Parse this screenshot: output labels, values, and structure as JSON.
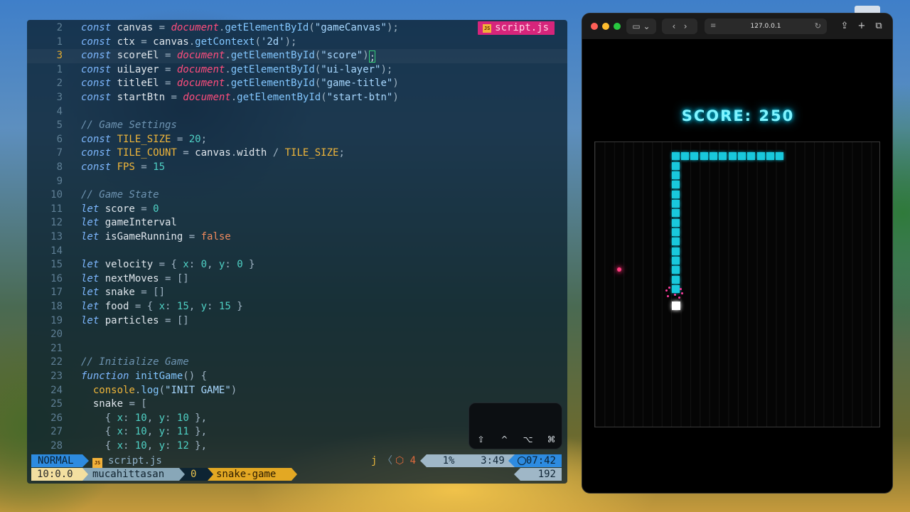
{
  "editor": {
    "file_tab": "script.js",
    "file_badge": "JS",
    "lines": [
      {
        "n": "2",
        "parts": [
          [
            "kw",
            "const "
          ],
          [
            "var",
            "canvas "
          ],
          [
            "punct",
            "= "
          ],
          [
            "glob",
            "document"
          ],
          [
            "punct",
            "."
          ],
          [
            "fn",
            "getElementById"
          ],
          [
            "punct",
            "("
          ],
          [
            "str",
            "\"gameCanvas\""
          ],
          [
            "punct",
            ");"
          ]
        ]
      },
      {
        "n": "1",
        "parts": [
          [
            "kw",
            "const "
          ],
          [
            "var",
            "ctx "
          ],
          [
            "punct",
            "= "
          ],
          [
            "var",
            "canvas"
          ],
          [
            "punct",
            "."
          ],
          [
            "fn",
            "getContext"
          ],
          [
            "punct",
            "("
          ],
          [
            "str",
            "'2d'"
          ],
          [
            "punct",
            ");"
          ]
        ]
      },
      {
        "n": "3",
        "cur": true,
        "parts": [
          [
            "kw",
            "const "
          ],
          [
            "var",
            "scoreEl "
          ],
          [
            "punct",
            "= "
          ],
          [
            "glob",
            "document"
          ],
          [
            "punct",
            "."
          ],
          [
            "fn",
            "getElementById"
          ],
          [
            "punct",
            "("
          ],
          [
            "str",
            "\"score\""
          ],
          [
            "punct",
            ")"
          ],
          [
            "caret",
            ";"
          ]
        ]
      },
      {
        "n": "1",
        "parts": [
          [
            "kw",
            "const "
          ],
          [
            "var",
            "uiLayer "
          ],
          [
            "punct",
            "= "
          ],
          [
            "glob",
            "document"
          ],
          [
            "punct",
            "."
          ],
          [
            "fn",
            "getElementById"
          ],
          [
            "punct",
            "("
          ],
          [
            "str",
            "\"ui-layer\""
          ],
          [
            "punct",
            ");"
          ]
        ]
      },
      {
        "n": "2",
        "parts": [
          [
            "kw",
            "const "
          ],
          [
            "var",
            "titleEl "
          ],
          [
            "punct",
            "= "
          ],
          [
            "glob",
            "document"
          ],
          [
            "punct",
            "."
          ],
          [
            "fn",
            "getElementById"
          ],
          [
            "punct",
            "("
          ],
          [
            "str",
            "\"game-title\""
          ],
          [
            "punct",
            ")"
          ]
        ]
      },
      {
        "n": "3",
        "parts": [
          [
            "kw",
            "const "
          ],
          [
            "var",
            "startBtn "
          ],
          [
            "punct",
            "= "
          ],
          [
            "glob",
            "document"
          ],
          [
            "punct",
            "."
          ],
          [
            "fn",
            "getElementById"
          ],
          [
            "punct",
            "("
          ],
          [
            "str",
            "\"start-btn\""
          ],
          [
            "punct",
            ")"
          ]
        ]
      },
      {
        "n": "4",
        "parts": []
      },
      {
        "n": "5",
        "parts": [
          [
            "cmt",
            "// Game Settings"
          ]
        ]
      },
      {
        "n": "6",
        "parts": [
          [
            "kw",
            "const "
          ],
          [
            "const",
            "TILE_SIZE "
          ],
          [
            "punct",
            "= "
          ],
          [
            "num",
            "20"
          ],
          [
            "punct",
            ";"
          ]
        ]
      },
      {
        "n": "7",
        "parts": [
          [
            "kw",
            "const "
          ],
          [
            "const",
            "TILE_COUNT "
          ],
          [
            "punct",
            "= "
          ],
          [
            "var",
            "canvas"
          ],
          [
            "punct",
            "."
          ],
          [
            "var",
            "width "
          ],
          [
            "punct",
            "/ "
          ],
          [
            "const",
            "TILE_SIZE"
          ],
          [
            "punct",
            ";"
          ]
        ]
      },
      {
        "n": "8",
        "parts": [
          [
            "kw",
            "const "
          ],
          [
            "const",
            "FPS "
          ],
          [
            "punct",
            "= "
          ],
          [
            "num",
            "15"
          ]
        ]
      },
      {
        "n": "9",
        "parts": []
      },
      {
        "n": "10",
        "parts": [
          [
            "cmt",
            "// Game State"
          ]
        ]
      },
      {
        "n": "11",
        "parts": [
          [
            "kw",
            "let "
          ],
          [
            "var",
            "score "
          ],
          [
            "punct",
            "= "
          ],
          [
            "num",
            "0"
          ]
        ]
      },
      {
        "n": "12",
        "parts": [
          [
            "kw",
            "let "
          ],
          [
            "var",
            "gameInterval"
          ]
        ]
      },
      {
        "n": "13",
        "parts": [
          [
            "kw",
            "let "
          ],
          [
            "var",
            "isGameRunning "
          ],
          [
            "punct",
            "= "
          ],
          [
            "bool",
            "false"
          ]
        ]
      },
      {
        "n": "14",
        "parts": []
      },
      {
        "n": "15",
        "parts": [
          [
            "kw",
            "let "
          ],
          [
            "var",
            "velocity "
          ],
          [
            "punct",
            "= { "
          ],
          [
            "num",
            "x"
          ],
          [
            "punct",
            ": "
          ],
          [
            "num",
            "0"
          ],
          [
            "punct",
            ", "
          ],
          [
            "num",
            "y"
          ],
          [
            "punct",
            ": "
          ],
          [
            "num",
            "0"
          ],
          [
            "punct",
            " }"
          ]
        ]
      },
      {
        "n": "16",
        "parts": [
          [
            "kw",
            "let "
          ],
          [
            "var",
            "nextMoves "
          ],
          [
            "punct",
            "= []"
          ]
        ]
      },
      {
        "n": "17",
        "parts": [
          [
            "kw",
            "let "
          ],
          [
            "var",
            "snake "
          ],
          [
            "punct",
            "= []"
          ]
        ]
      },
      {
        "n": "18",
        "parts": [
          [
            "kw",
            "let "
          ],
          [
            "var",
            "food "
          ],
          [
            "punct",
            "= { "
          ],
          [
            "num",
            "x"
          ],
          [
            "punct",
            ": "
          ],
          [
            "num",
            "15"
          ],
          [
            "punct",
            ", "
          ],
          [
            "num",
            "y"
          ],
          [
            "punct",
            ": "
          ],
          [
            "num",
            "15"
          ],
          [
            "punct",
            " }"
          ]
        ]
      },
      {
        "n": "19",
        "parts": [
          [
            "kw",
            "let "
          ],
          [
            "var",
            "particles "
          ],
          [
            "punct",
            "= []"
          ]
        ]
      },
      {
        "n": "20",
        "parts": []
      },
      {
        "n": "21",
        "parts": []
      },
      {
        "n": "22",
        "parts": [
          [
            "cmt",
            "// Initialize Game"
          ]
        ]
      },
      {
        "n": "23",
        "parts": [
          [
            "kw",
            "function "
          ],
          [
            "fn",
            "initGame"
          ],
          [
            "punct",
            "() {"
          ]
        ]
      },
      {
        "n": "24",
        "parts": [
          [
            "punct",
            "  "
          ],
          [
            "const",
            "console"
          ],
          [
            "punct",
            "."
          ],
          [
            "fn",
            "log"
          ],
          [
            "punct",
            "("
          ],
          [
            "str",
            "\"INIT GAME\""
          ],
          [
            "punct",
            ")"
          ]
        ]
      },
      {
        "n": "25",
        "parts": [
          [
            "punct",
            "  "
          ],
          [
            "var",
            "snake "
          ],
          [
            "punct",
            "= ["
          ]
        ]
      },
      {
        "n": "26",
        "parts": [
          [
            "punct",
            "    { "
          ],
          [
            "num",
            "x"
          ],
          [
            "punct",
            ": "
          ],
          [
            "num",
            "10"
          ],
          [
            "punct",
            ", "
          ],
          [
            "num",
            "y"
          ],
          [
            "punct",
            ": "
          ],
          [
            "num",
            "10"
          ],
          [
            "punct",
            " },"
          ]
        ]
      },
      {
        "n": "27",
        "parts": [
          [
            "punct",
            "    { "
          ],
          [
            "num",
            "x"
          ],
          [
            "punct",
            ": "
          ],
          [
            "num",
            "10"
          ],
          [
            "punct",
            ", "
          ],
          [
            "num",
            "y"
          ],
          [
            "punct",
            ": "
          ],
          [
            "num",
            "11"
          ],
          [
            "punct",
            " },"
          ]
        ]
      },
      {
        "n": "28",
        "parts": [
          [
            "punct",
            "    { "
          ],
          [
            "num",
            "x"
          ],
          [
            "punct",
            ": "
          ],
          [
            "num",
            "10"
          ],
          [
            "punct",
            ", "
          ],
          [
            "num",
            "y"
          ],
          [
            "punct",
            ": "
          ],
          [
            "num",
            "12"
          ],
          [
            "punct",
            " },"
          ]
        ]
      }
    ]
  },
  "keyboard_overlay": {
    "keys": [
      "⇧",
      "^",
      "⌥",
      "⌘"
    ]
  },
  "statusline": {
    "mode": "NORMAL",
    "file": "script.js",
    "file_badge": "JS",
    "key": "j",
    "chevron": "〈",
    "diagnostics_icon": "⬡",
    "diagnostics_count": "4",
    "percent": "1%",
    "position": "3:49",
    "time": "07:42"
  },
  "tmux": {
    "session": "10:0.0",
    "user": "mucahittasan",
    "window_index": "0",
    "window_name": "snake-game",
    "count": "192"
  },
  "browser": {
    "address": "127.0.0.1",
    "score_label": "SCORE: 250"
  },
  "game": {
    "grid": 30,
    "snake_color": "#19c8dc",
    "food_color": "#ff3d7f",
    "snake": [
      [
        8,
        1
      ],
      [
        9,
        1
      ],
      [
        10,
        1
      ],
      [
        11,
        1
      ],
      [
        12,
        1
      ],
      [
        13,
        1
      ],
      [
        14,
        1
      ],
      [
        15,
        1
      ],
      [
        16,
        1
      ],
      [
        17,
        1
      ],
      [
        18,
        1
      ],
      [
        19,
        1
      ],
      [
        8,
        2
      ],
      [
        8,
        3
      ],
      [
        8,
        4
      ],
      [
        8,
        5
      ],
      [
        8,
        6
      ],
      [
        8,
        7
      ],
      [
        8,
        8
      ],
      [
        8,
        9
      ],
      [
        8,
        10
      ],
      [
        8,
        11
      ],
      [
        8,
        12
      ],
      [
        8,
        13
      ],
      [
        8,
        14
      ],
      [
        8,
        15
      ]
    ],
    "head": [
      8,
      17
    ],
    "food": [
      2,
      13
    ]
  }
}
